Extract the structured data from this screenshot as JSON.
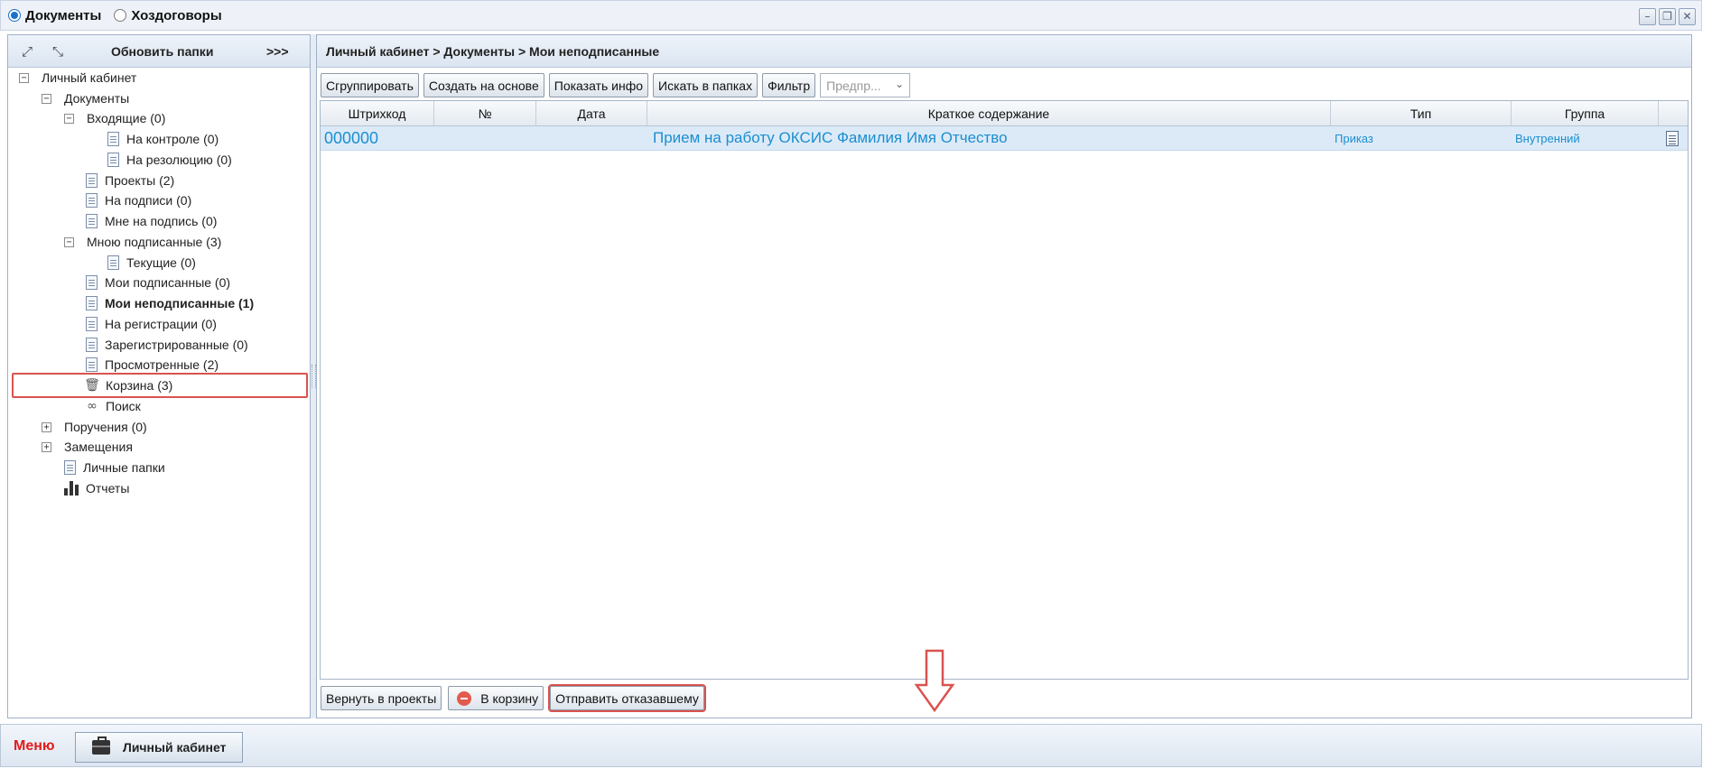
{
  "topbar": {
    "radio_documents": "Документы",
    "radio_contracts": "Хоздоговоры",
    "selected": "Документы",
    "win_buttons": [
      "minimize-icon",
      "restore-icon",
      "close-icon"
    ]
  },
  "left_panel": {
    "refresh_label": "Обновить папки",
    "more_label": ">>>",
    "expand_icon": "expand-all-icon",
    "collapse_icon": "collapse-all-icon",
    "tree": [
      {
        "label": "Личный кабинет",
        "toggle": "−"
      },
      {
        "label": "Документы",
        "toggle": "−"
      },
      {
        "label": "Входящие (0)",
        "toggle": "−"
      },
      {
        "label": "На контроле (0)",
        "icon": "document-icon"
      },
      {
        "label": "На резолюцию (0)",
        "icon": "document-icon"
      },
      {
        "label": "Проекты (2)",
        "icon": "document-icon"
      },
      {
        "label": "На подписи (0)",
        "icon": "document-icon"
      },
      {
        "label": "Мне на подпись (0)",
        "icon": "document-icon"
      },
      {
        "label": "Мною подписанные (3)",
        "toggle": "−"
      },
      {
        "label": "Текущие (0)",
        "icon": "document-icon"
      },
      {
        "label": "Мои подписанные (0)",
        "icon": "document-icon"
      },
      {
        "label": "Мои неподписанные (1)",
        "icon": "document-icon",
        "selected": true
      },
      {
        "label": "На регистрации (0)",
        "icon": "document-icon"
      },
      {
        "label": "Зарегистрированные (0)",
        "icon": "document-icon"
      },
      {
        "label": "Просмотренные (2)",
        "icon": "document-icon"
      },
      {
        "label": "Корзина (3)",
        "icon": "trash-icon"
      },
      {
        "label": "Поиск",
        "icon": "binoculars-icon"
      },
      {
        "label": "Поручения (0)",
        "toggle": "+"
      },
      {
        "label": "Замещения",
        "toggle": "+"
      },
      {
        "label": "Личные папки",
        "icon": "document-icon"
      },
      {
        "label": "Отчеты",
        "icon": "bar-chart-icon"
      }
    ]
  },
  "right_panel": {
    "breadcrumb": "Личный кабинет > Документы > Мои неподписанные",
    "toolbar": {
      "group": "Сгруппировать",
      "create_based": "Создать на основе",
      "show_info": "Показать инфо",
      "find_in_folders": "Искать в папках",
      "filter": "Фильтр",
      "preset_placeholder": "Предпр..."
    },
    "columns": [
      "Штрихкод",
      "№",
      "Дата",
      "Краткое содержание",
      "Тип",
      "Группа"
    ],
    "rows": [
      {
        "barcode": "000000",
        "number": "",
        "date": "",
        "summary": "Прием на работу ОКСИС Фамилия Имя Отчество",
        "type": "Приказ",
        "group": "Внутренний",
        "icon": "document-icon"
      }
    ],
    "bottom": {
      "return_to_projects": "Вернуть в проекты",
      "to_trash": "В корзину",
      "send_to_refuser": "Отправить отказавшему"
    }
  },
  "footer": {
    "menu": "Меню",
    "task_button": "Личный кабинет",
    "task_icon": "briefcase-icon"
  },
  "colors": {
    "link_blue": "#1b8fd0",
    "selection_bg": "#dceaf8",
    "highlight_red": "#d9534f",
    "menu_red": "#e31c1c"
  }
}
